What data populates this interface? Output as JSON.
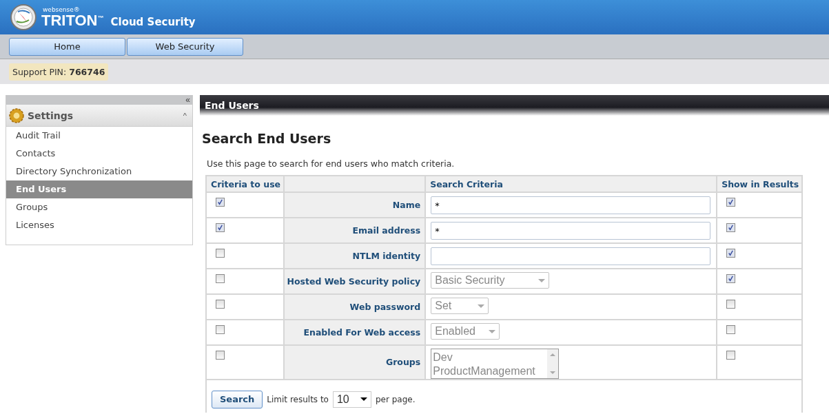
{
  "header": {
    "brand_small": "websense®",
    "brand": "TRITON$^{™}$",
    "product": "Cloud Security"
  },
  "nav_tabs": [
    {
      "label": "Home",
      "selected": false
    },
    {
      "label": "Web Security",
      "selected": false
    }
  ],
  "support": {
    "label": "Support PIN:",
    "pin": "766746"
  },
  "sidebar": {
    "collapse": "«",
    "section": {
      "title": "Settings",
      "toggle": "^",
      "expanded": true
    },
    "items": [
      {
        "label": "Audit Trail",
        "selected": false
      },
      {
        "label": "Contacts",
        "selected": false
      },
      {
        "label": "Directory Synchronization",
        "selected": false
      },
      {
        "label": "End Users",
        "selected": true
      },
      {
        "label": "Groups",
        "selected": false
      },
      {
        "label": "Licenses",
        "selected": false
      }
    ]
  },
  "page_bar": "End Users",
  "heading": "Search End Users",
  "description": "Use this page to search for end users who match criteria.",
  "table": {
    "columns": [
      "Criteria to use",
      "",
      "Search Criteria",
      "Show in Results"
    ],
    "rows": [
      {
        "use": true,
        "label": "Name",
        "kind": "text",
        "value": "*",
        "show": true
      },
      {
        "use": true,
        "label": "Email address",
        "kind": "text",
        "value": "*",
        "show": true
      },
      {
        "use": false,
        "label": "NTLM identity",
        "kind": "text",
        "show": true
      },
      {
        "use": false,
        "label": "Hosted Web Security policy",
        "kind": "select",
        "value": "Basic Security",
        "show": true
      },
      {
        "use": false,
        "label": "Web password",
        "kind": "select",
        "value": "Set",
        "show": false
      },
      {
        "use": false,
        "label": "Enabled For Web access",
        "kind": "select",
        "value": "Enabled",
        "show": false
      },
      {
        "use": false,
        "label": "Groups",
        "kind": "list",
        "options": [
          "Dev",
          "ProductManagement"
        ],
        "show": false
      }
    ]
  },
  "footer": {
    "button": "Search",
    "limit_label": "Limit results to",
    "limit": "10",
    "per_page": "per page."
  }
}
